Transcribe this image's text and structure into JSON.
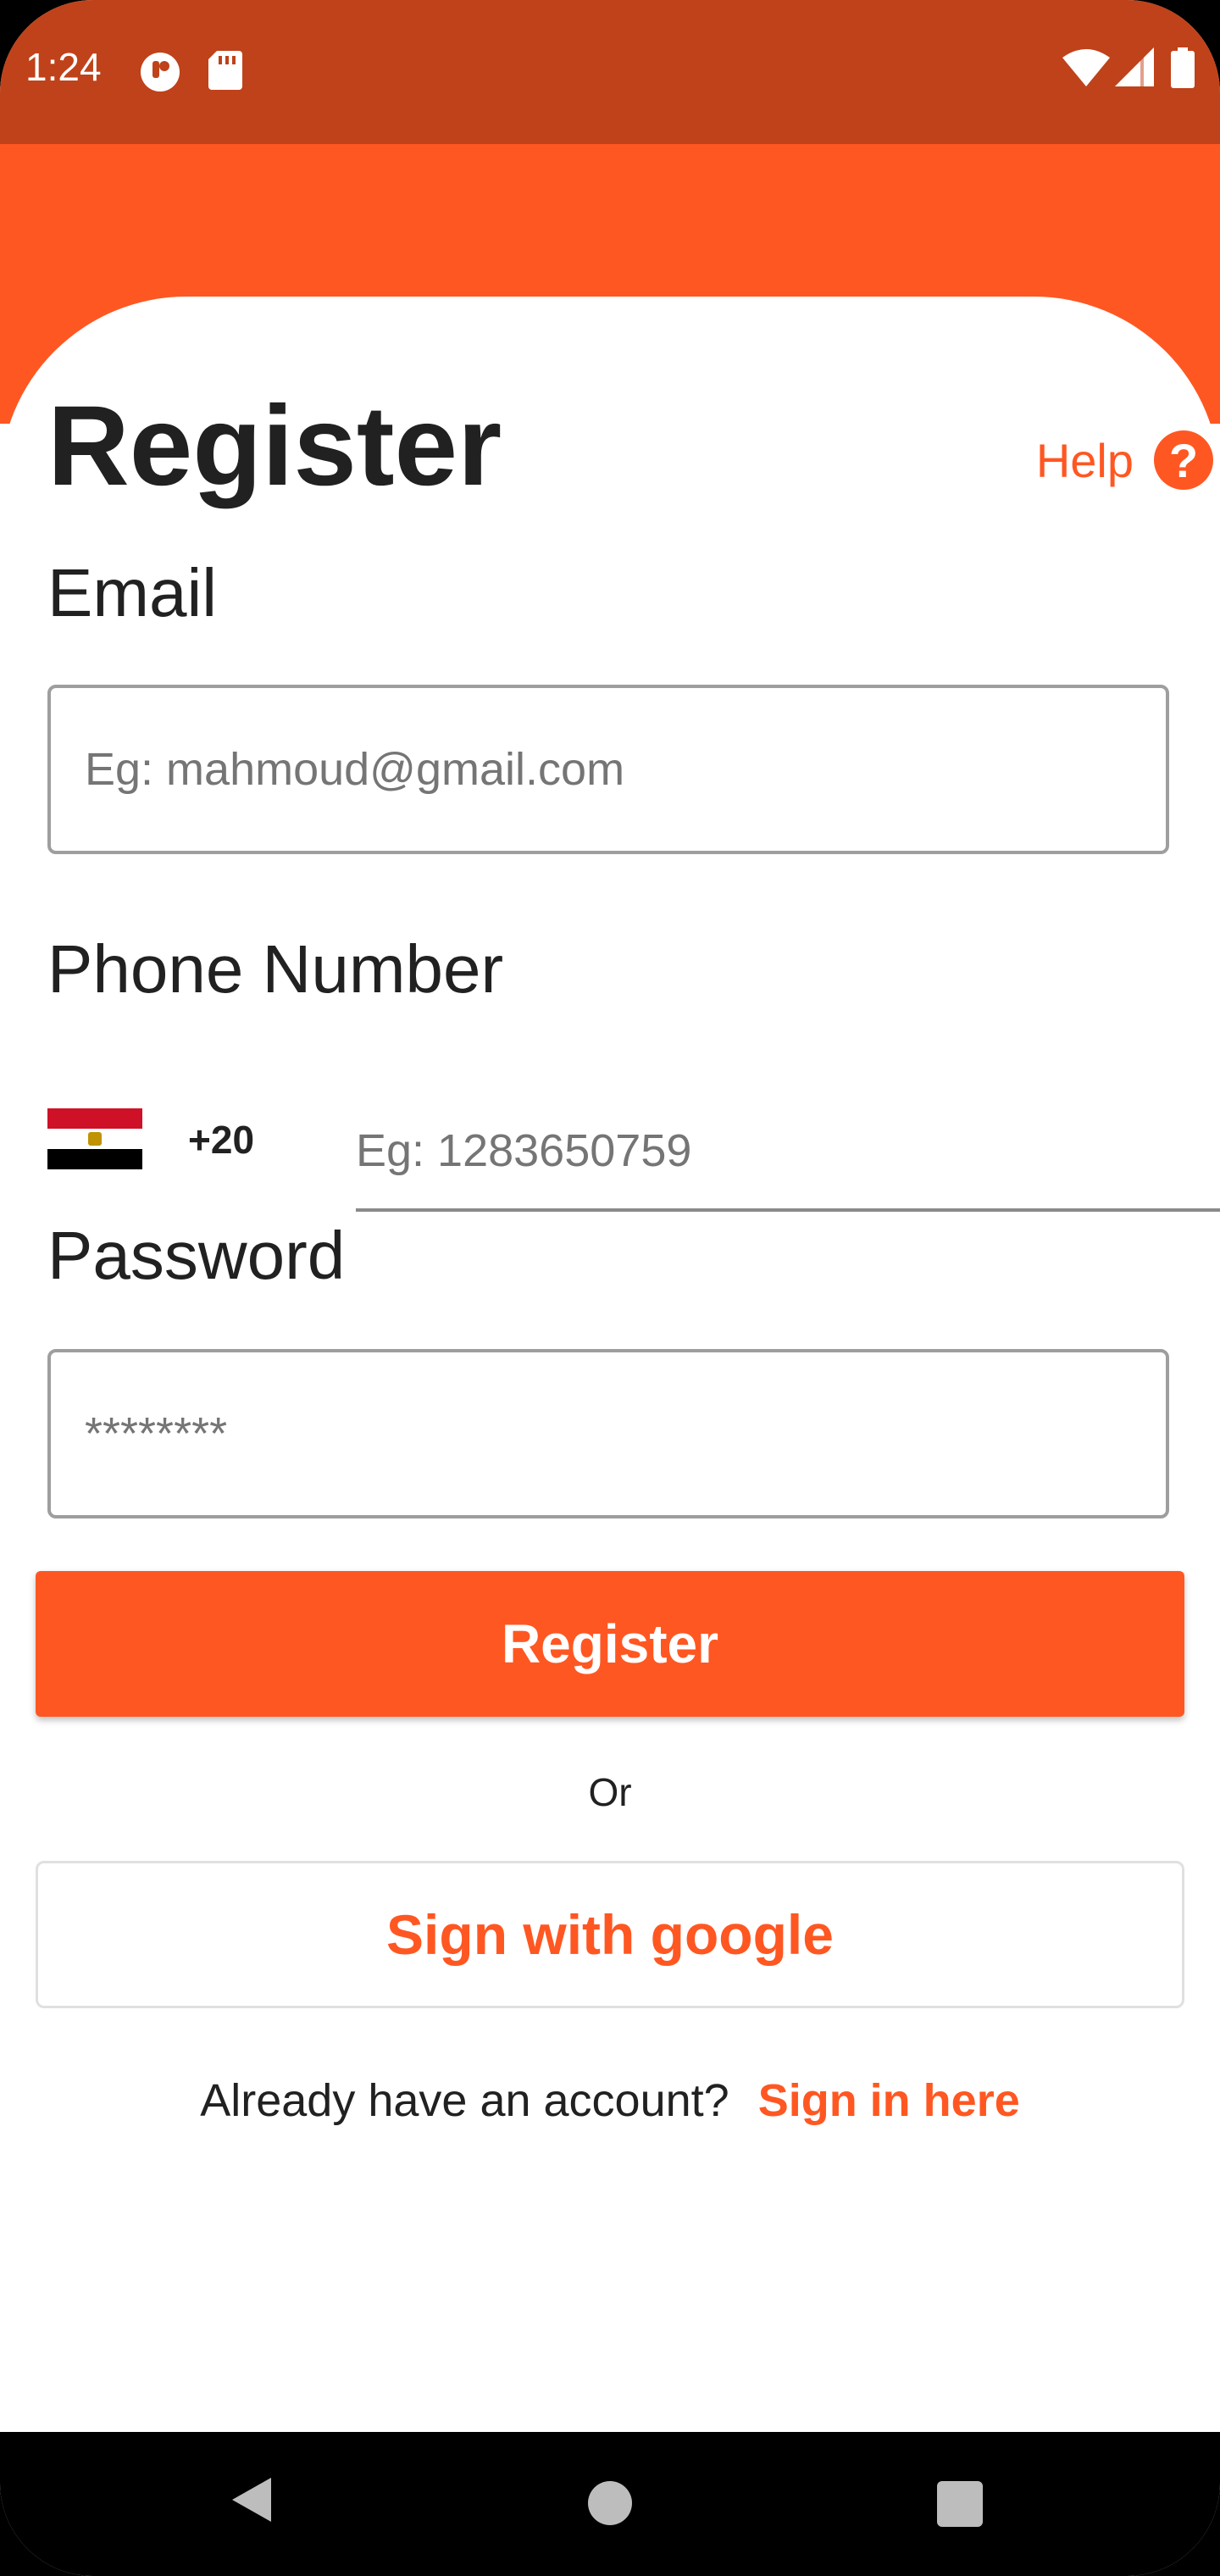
{
  "status_bar": {
    "time": "1:24",
    "left_icons": [
      "app-notification-icon",
      "sd-card-icon"
    ],
    "right_icons": [
      "wifi-icon",
      "cellular-signal-icon",
      "battery-icon"
    ],
    "background": "#BF421A"
  },
  "header": {
    "title": "Register",
    "help_label": "Help",
    "help_glyph": "?",
    "accent_color": "#FF5722"
  },
  "form": {
    "email": {
      "label": "Email",
      "placeholder": "Eg: mahmoud@gmail.com"
    },
    "phone": {
      "label": "Phone Number",
      "country_flag": "egypt-flag-icon",
      "dial_code": "+20",
      "placeholder": "Eg: 1283650759"
    },
    "password": {
      "label": "Password",
      "placeholder": "********"
    },
    "register_button": "Register",
    "divider_text": "Or",
    "google_button": "Sign with google",
    "signin_prompt": "Already have an account?",
    "signin_link": "Sign in here"
  },
  "nav_bar": {
    "icons": [
      "back-icon",
      "home-icon",
      "recents-icon"
    ]
  }
}
